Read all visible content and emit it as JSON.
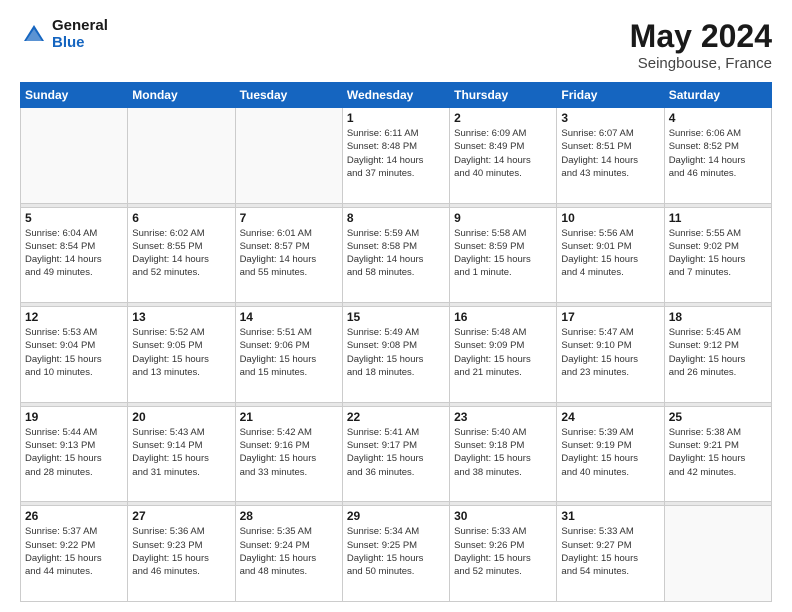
{
  "logo": {
    "general": "General",
    "blue": "Blue"
  },
  "header": {
    "title": "May 2024",
    "subtitle": "Seingbouse, France"
  },
  "days_of_week": [
    "Sunday",
    "Monday",
    "Tuesday",
    "Wednesday",
    "Thursday",
    "Friday",
    "Saturday"
  ],
  "weeks": [
    {
      "days": [
        {
          "num": "",
          "info": ""
        },
        {
          "num": "",
          "info": ""
        },
        {
          "num": "",
          "info": ""
        },
        {
          "num": "1",
          "info": "Sunrise: 6:11 AM\nSunset: 8:48 PM\nDaylight: 14 hours\nand 37 minutes."
        },
        {
          "num": "2",
          "info": "Sunrise: 6:09 AM\nSunset: 8:49 PM\nDaylight: 14 hours\nand 40 minutes."
        },
        {
          "num": "3",
          "info": "Sunrise: 6:07 AM\nSunset: 8:51 PM\nDaylight: 14 hours\nand 43 minutes."
        },
        {
          "num": "4",
          "info": "Sunrise: 6:06 AM\nSunset: 8:52 PM\nDaylight: 14 hours\nand 46 minutes."
        }
      ]
    },
    {
      "days": [
        {
          "num": "5",
          "info": "Sunrise: 6:04 AM\nSunset: 8:54 PM\nDaylight: 14 hours\nand 49 minutes."
        },
        {
          "num": "6",
          "info": "Sunrise: 6:02 AM\nSunset: 8:55 PM\nDaylight: 14 hours\nand 52 minutes."
        },
        {
          "num": "7",
          "info": "Sunrise: 6:01 AM\nSunset: 8:57 PM\nDaylight: 14 hours\nand 55 minutes."
        },
        {
          "num": "8",
          "info": "Sunrise: 5:59 AM\nSunset: 8:58 PM\nDaylight: 14 hours\nand 58 minutes."
        },
        {
          "num": "9",
          "info": "Sunrise: 5:58 AM\nSunset: 8:59 PM\nDaylight: 15 hours\nand 1 minute."
        },
        {
          "num": "10",
          "info": "Sunrise: 5:56 AM\nSunset: 9:01 PM\nDaylight: 15 hours\nand 4 minutes."
        },
        {
          "num": "11",
          "info": "Sunrise: 5:55 AM\nSunset: 9:02 PM\nDaylight: 15 hours\nand 7 minutes."
        }
      ]
    },
    {
      "days": [
        {
          "num": "12",
          "info": "Sunrise: 5:53 AM\nSunset: 9:04 PM\nDaylight: 15 hours\nand 10 minutes."
        },
        {
          "num": "13",
          "info": "Sunrise: 5:52 AM\nSunset: 9:05 PM\nDaylight: 15 hours\nand 13 minutes."
        },
        {
          "num": "14",
          "info": "Sunrise: 5:51 AM\nSunset: 9:06 PM\nDaylight: 15 hours\nand 15 minutes."
        },
        {
          "num": "15",
          "info": "Sunrise: 5:49 AM\nSunset: 9:08 PM\nDaylight: 15 hours\nand 18 minutes."
        },
        {
          "num": "16",
          "info": "Sunrise: 5:48 AM\nSunset: 9:09 PM\nDaylight: 15 hours\nand 21 minutes."
        },
        {
          "num": "17",
          "info": "Sunrise: 5:47 AM\nSunset: 9:10 PM\nDaylight: 15 hours\nand 23 minutes."
        },
        {
          "num": "18",
          "info": "Sunrise: 5:45 AM\nSunset: 9:12 PM\nDaylight: 15 hours\nand 26 minutes."
        }
      ]
    },
    {
      "days": [
        {
          "num": "19",
          "info": "Sunrise: 5:44 AM\nSunset: 9:13 PM\nDaylight: 15 hours\nand 28 minutes."
        },
        {
          "num": "20",
          "info": "Sunrise: 5:43 AM\nSunset: 9:14 PM\nDaylight: 15 hours\nand 31 minutes."
        },
        {
          "num": "21",
          "info": "Sunrise: 5:42 AM\nSunset: 9:16 PM\nDaylight: 15 hours\nand 33 minutes."
        },
        {
          "num": "22",
          "info": "Sunrise: 5:41 AM\nSunset: 9:17 PM\nDaylight: 15 hours\nand 36 minutes."
        },
        {
          "num": "23",
          "info": "Sunrise: 5:40 AM\nSunset: 9:18 PM\nDaylight: 15 hours\nand 38 minutes."
        },
        {
          "num": "24",
          "info": "Sunrise: 5:39 AM\nSunset: 9:19 PM\nDaylight: 15 hours\nand 40 minutes."
        },
        {
          "num": "25",
          "info": "Sunrise: 5:38 AM\nSunset: 9:21 PM\nDaylight: 15 hours\nand 42 minutes."
        }
      ]
    },
    {
      "days": [
        {
          "num": "26",
          "info": "Sunrise: 5:37 AM\nSunset: 9:22 PM\nDaylight: 15 hours\nand 44 minutes."
        },
        {
          "num": "27",
          "info": "Sunrise: 5:36 AM\nSunset: 9:23 PM\nDaylight: 15 hours\nand 46 minutes."
        },
        {
          "num": "28",
          "info": "Sunrise: 5:35 AM\nSunset: 9:24 PM\nDaylight: 15 hours\nand 48 minutes."
        },
        {
          "num": "29",
          "info": "Sunrise: 5:34 AM\nSunset: 9:25 PM\nDaylight: 15 hours\nand 50 minutes."
        },
        {
          "num": "30",
          "info": "Sunrise: 5:33 AM\nSunset: 9:26 PM\nDaylight: 15 hours\nand 52 minutes."
        },
        {
          "num": "31",
          "info": "Sunrise: 5:33 AM\nSunset: 9:27 PM\nDaylight: 15 hours\nand 54 minutes."
        },
        {
          "num": "",
          "info": ""
        }
      ]
    }
  ]
}
